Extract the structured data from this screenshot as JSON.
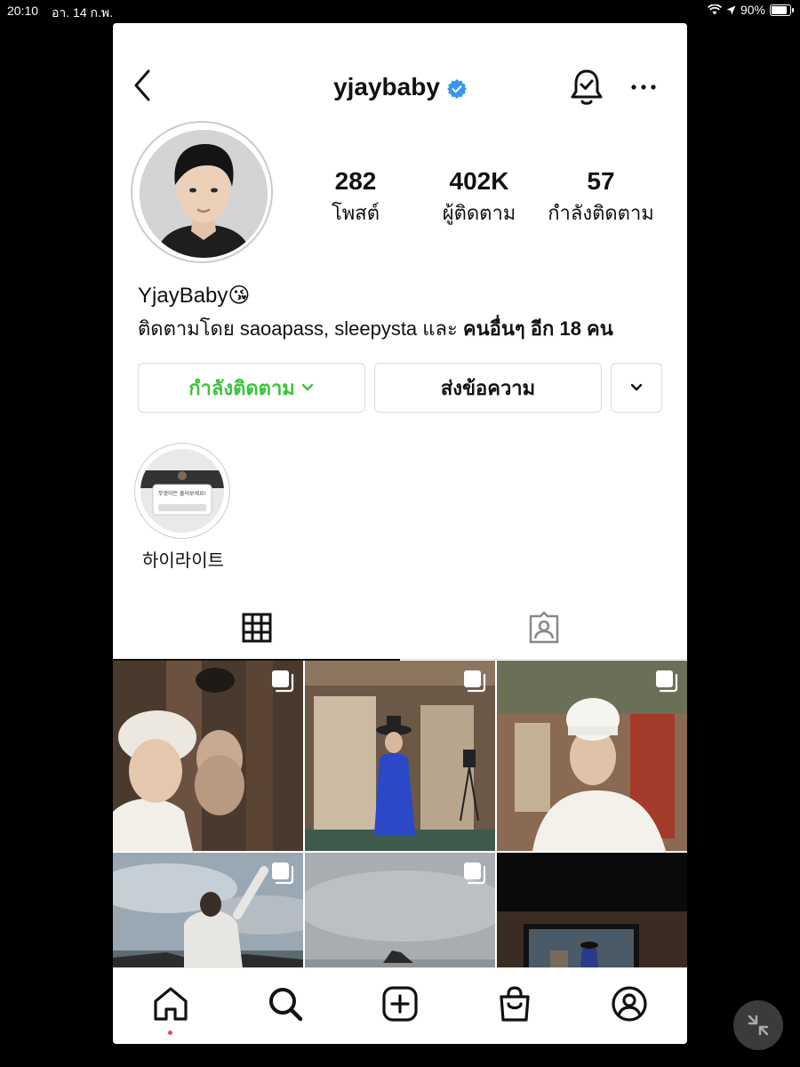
{
  "status_bar": {
    "time": "20:10",
    "date": "อา. 14 ก.พ.",
    "battery": "90%"
  },
  "header": {
    "username": "yjaybaby"
  },
  "stats": [
    {
      "value": "282",
      "label": "โพสต์"
    },
    {
      "value": "402K",
      "label": "ผู้ติดตาม"
    },
    {
      "value": "57",
      "label": "กำลังติดตาม"
    }
  ],
  "bio": {
    "name": "YjayBaby😘",
    "followed_prefix": "ติดตามโดย saoapass, sleepysta และ ",
    "followed_more": "คนอื่นๆ อีก 18 คน"
  },
  "buttons": {
    "following": "กำลังติดตาม",
    "message": "ส่งข้อความ"
  },
  "highlights": [
    {
      "label": "하이라이트",
      "caption": "무엇이든 물어보세요!"
    }
  ],
  "tabs": [
    {
      "icon": "grid-icon",
      "active": true
    },
    {
      "icon": "tagged-icon",
      "active": false
    }
  ],
  "bottom_nav": [
    "home-icon",
    "search-icon",
    "create-icon",
    "shop-icon",
    "profile-icon"
  ],
  "colors": {
    "accent_green": "#3ac43a",
    "verified_blue": "#3897f0",
    "notification_red": "#ed4956"
  }
}
